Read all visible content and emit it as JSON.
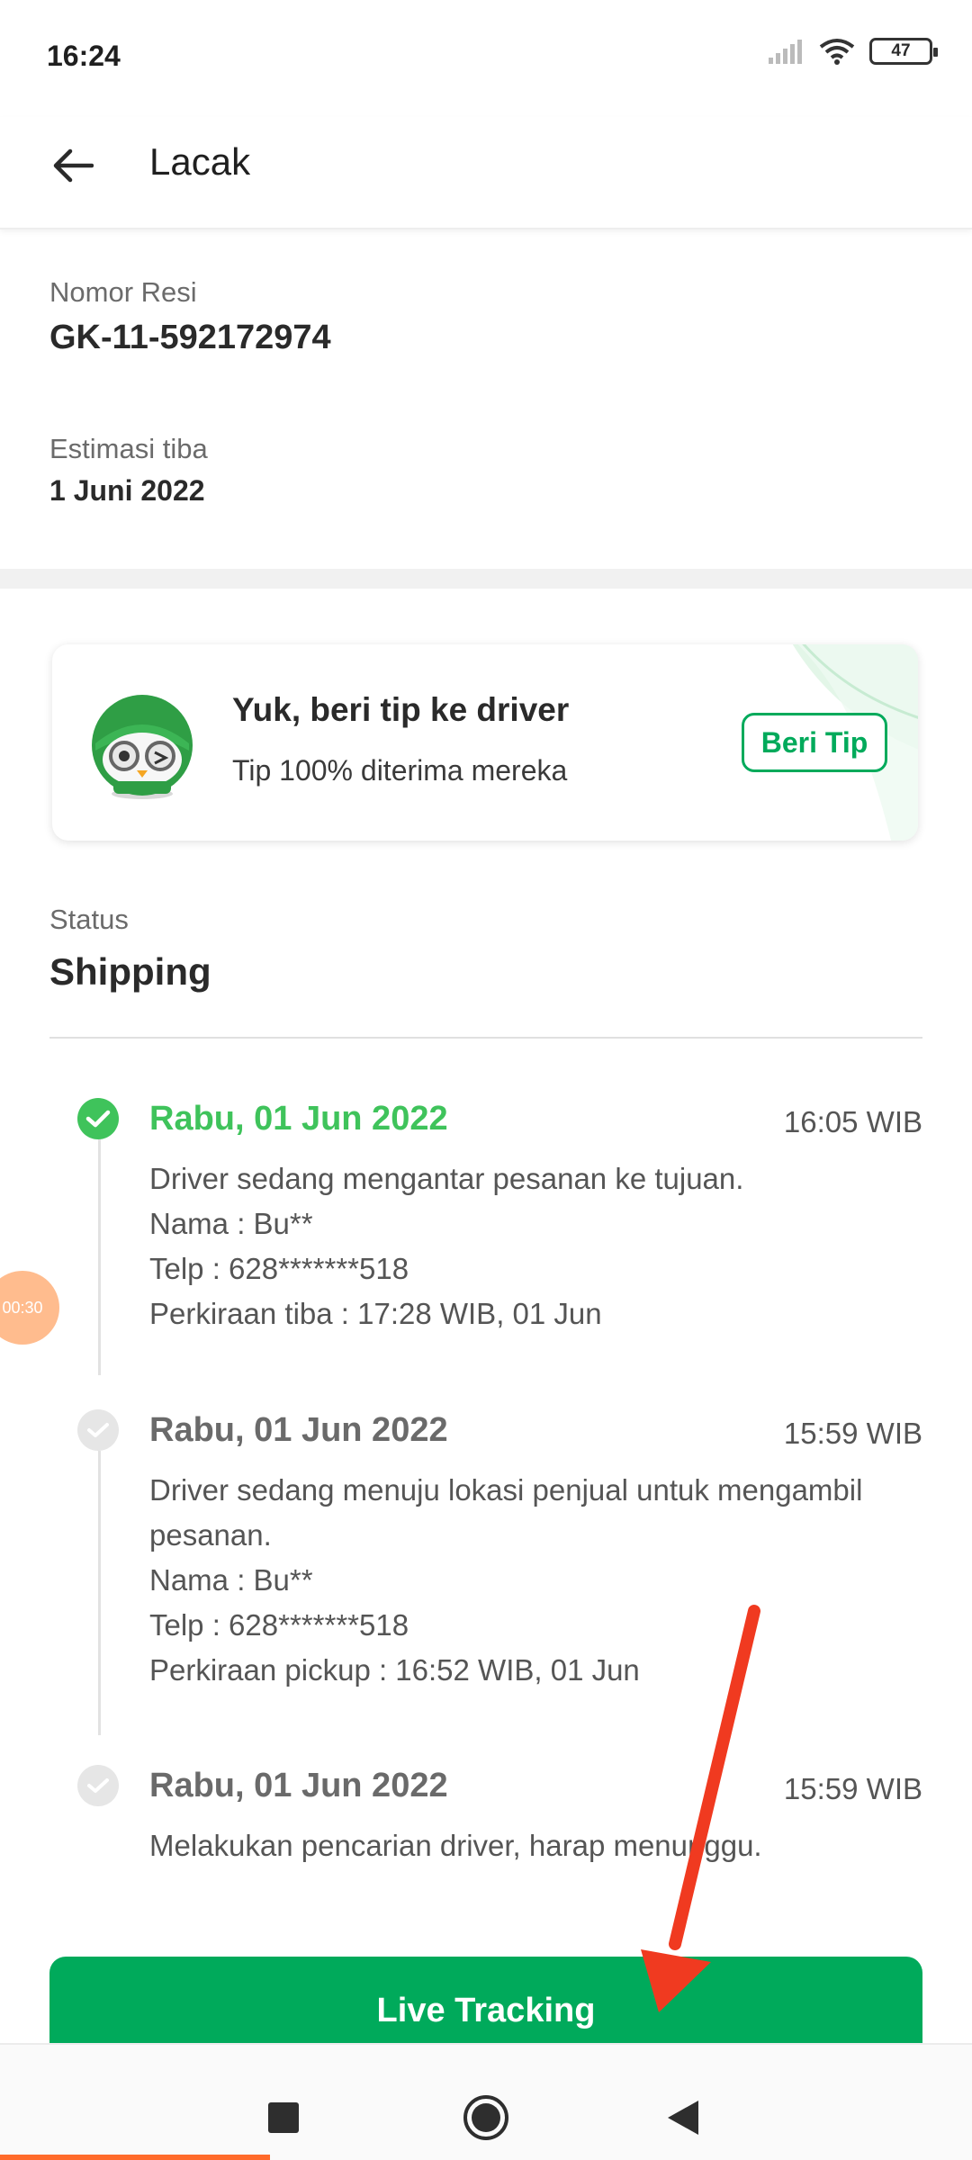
{
  "status_bar": {
    "time": "16:24",
    "battery": "47"
  },
  "header": {
    "title": "Lacak"
  },
  "info": {
    "resi_label": "Nomor Resi",
    "resi_value": "GK-11-592172974",
    "eta_label": "Estimasi tiba",
    "eta_value": "1 Juni 2022"
  },
  "tip": {
    "title": "Yuk, beri tip ke driver",
    "subtitle": "Tip 100% diterima mereka",
    "button": "Beri Tip"
  },
  "status": {
    "label": "Status",
    "value": "Shipping"
  },
  "timeline": [
    {
      "date": "Rabu, 01 Jun 2022",
      "time": "16:05 WIB",
      "active": true,
      "lines": [
        "Driver sedang mengantar pesanan ke tujuan.",
        "Nama : Bu**",
        "Telp : 628*******518",
        "Perkiraan tiba : 17:28 WIB, 01 Jun"
      ]
    },
    {
      "date": "Rabu, 01 Jun 2022",
      "time": "15:59 WIB",
      "active": false,
      "lines": [
        "Driver sedang menuju lokasi penjual untuk mengambil",
        "pesanan.",
        "Nama : Bu**",
        "Telp : 628*******518",
        "Perkiraan pickup : 16:52 WIB, 01 Jun"
      ]
    },
    {
      "date": "Rabu, 01 Jun 2022",
      "time": "15:59 WIB",
      "active": false,
      "lines": [
        "Melakukan pencarian driver, harap menunggu."
      ]
    }
  ],
  "floating_bubble": "00:30",
  "live_tracking_button": "Live Tracking",
  "colors": {
    "primary_green": "#00aa5b",
    "active_green": "#3fc35b",
    "annotation_red": "#f03a20"
  }
}
